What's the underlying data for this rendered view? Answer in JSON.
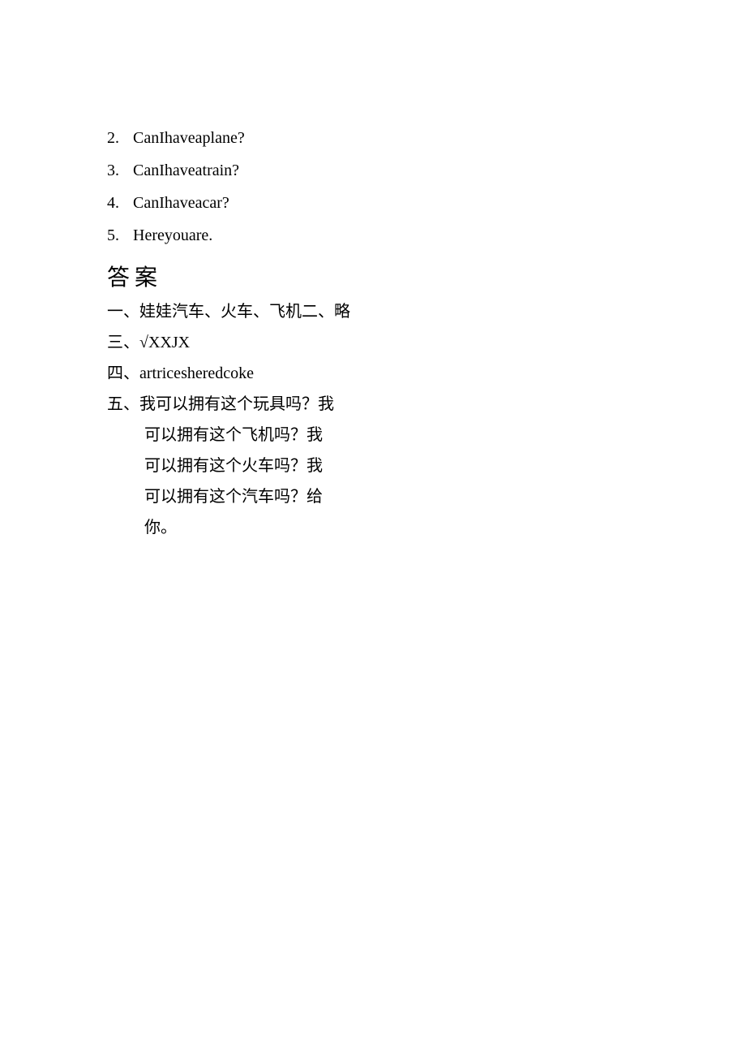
{
  "numbered": [
    {
      "n": "2.",
      "text": "CanIhaveaplane?"
    },
    {
      "n": "3.",
      "text": "CanIhaveatrain?"
    },
    {
      "n": "4.",
      "text": "CanIhaveacar?"
    },
    {
      "n": "5.",
      "text": "Hereyouare."
    }
  ],
  "answer_heading": "答案",
  "ans1": "一、娃娃汽车、火车、飞机二、略",
  "ans3": "三、√XXJX",
  "ans4": "四、artricesheredcoke",
  "five": [
    "五、我可以拥有这个玩具吗？我",
    "可以拥有这个飞机吗？我",
    "可以拥有这个火车吗？我",
    "可以拥有这个汽车吗？给",
    "你。"
  ]
}
